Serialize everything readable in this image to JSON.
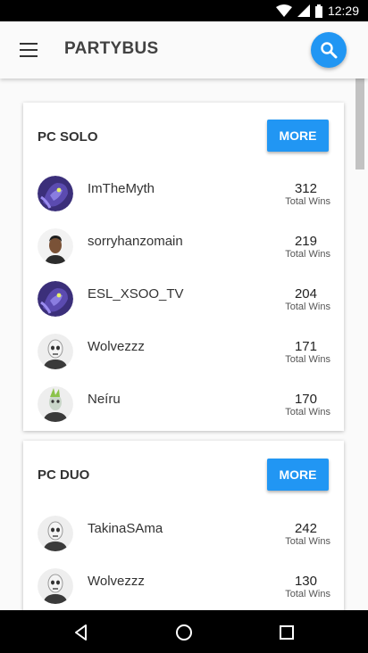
{
  "status": {
    "time": "12:29"
  },
  "appbar": {
    "title": "PARTYBUS"
  },
  "sections": [
    {
      "title": "PC SOLO",
      "more_label": "MORE",
      "players": [
        {
          "name": "ImTheMyth",
          "wins": "312",
          "wins_label": "Total Wins",
          "avatar": "dragon-skin"
        },
        {
          "name": "sorryhanzomain",
          "wins": "219",
          "wins_label": "Total Wins",
          "avatar": "default-skin"
        },
        {
          "name": "ESL_XSOO_TV",
          "wins": "204",
          "wins_label": "Total Wins",
          "avatar": "dragon-skin"
        },
        {
          "name": "Wolvezzz",
          "wins": "171",
          "wins_label": "Total Wins",
          "avatar": "skull-skin"
        },
        {
          "name": "Neíru",
          "wins": "170",
          "wins_label": "Total Wins",
          "avatar": "zombie-skin"
        }
      ]
    },
    {
      "title": "PC DUO",
      "more_label": "MORE",
      "players": [
        {
          "name": "TakinaSAma",
          "wins": "242",
          "wins_label": "Total Wins",
          "avatar": "skull-skin"
        },
        {
          "name": "Wolvezzz",
          "wins": "130",
          "wins_label": "Total Wins",
          "avatar": "skull-skin"
        }
      ]
    }
  ],
  "colors": {
    "accent": "#2196f3",
    "background": "#fafafa",
    "card": "#ffffff"
  }
}
